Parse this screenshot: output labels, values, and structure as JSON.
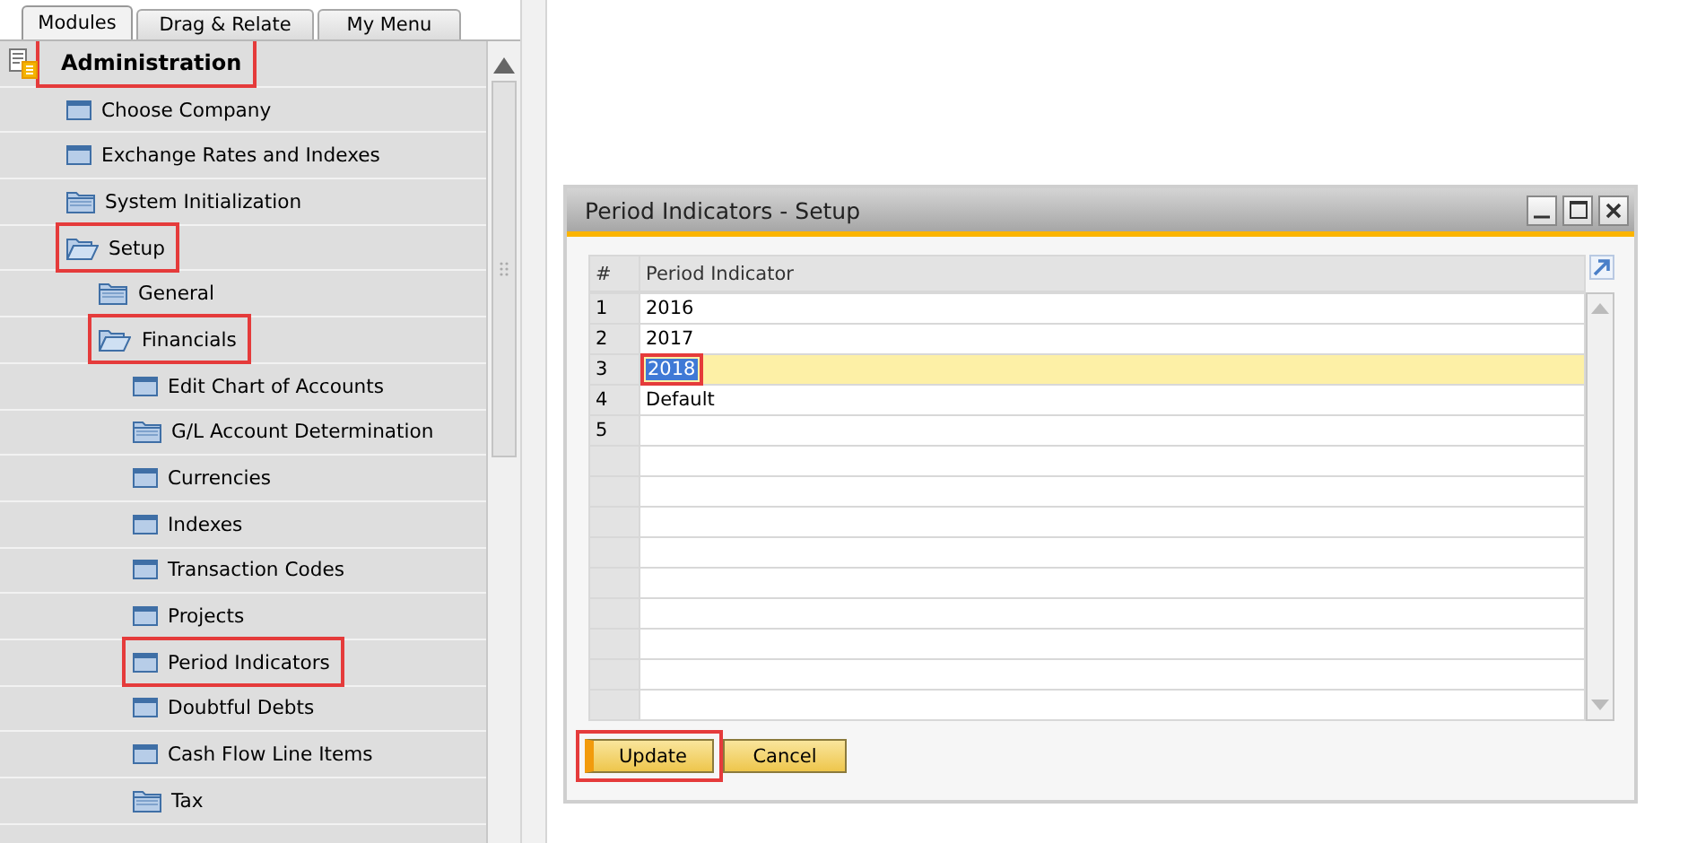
{
  "tabs": [
    {
      "label": "Modules",
      "selected": true
    },
    {
      "label": "Drag & Relate",
      "selected": false
    },
    {
      "label": "My Menu",
      "selected": false
    }
  ],
  "tree": [
    {
      "label": "Administration",
      "kind": "module",
      "highlighted": true,
      "children": [
        {
          "label": "Choose Company",
          "kind": "form",
          "highlighted": false
        },
        {
          "label": "Exchange Rates and Indexes",
          "kind": "form",
          "highlighted": false
        },
        {
          "label": "System Initialization",
          "kind": "folder",
          "expanded": false,
          "highlighted": false
        },
        {
          "label": "Setup",
          "kind": "folder",
          "expanded": true,
          "highlighted": true,
          "children": [
            {
              "label": "General",
              "kind": "folder",
              "expanded": false,
              "highlighted": false
            },
            {
              "label": "Financials",
              "kind": "folder",
              "expanded": true,
              "highlighted": true,
              "children": [
                {
                  "label": "Edit Chart of Accounts",
                  "kind": "form",
                  "highlighted": false
                },
                {
                  "label": "G/L Account Determination",
                  "kind": "folder",
                  "expanded": false,
                  "highlighted": false
                },
                {
                  "label": "Currencies",
                  "kind": "form",
                  "highlighted": false
                },
                {
                  "label": "Indexes",
                  "kind": "form",
                  "highlighted": false
                },
                {
                  "label": "Transaction Codes",
                  "kind": "form",
                  "highlighted": false
                },
                {
                  "label": "Projects",
                  "kind": "form",
                  "highlighted": false
                },
                {
                  "label": "Period Indicators",
                  "kind": "form",
                  "highlighted": true
                },
                {
                  "label": "Doubtful Debts",
                  "kind": "form",
                  "highlighted": false
                },
                {
                  "label": "Cash Flow Line Items",
                  "kind": "form",
                  "highlighted": false
                },
                {
                  "label": "Tax",
                  "kind": "folder",
                  "expanded": false,
                  "highlighted": false
                }
              ]
            }
          ]
        }
      ]
    }
  ],
  "dialog": {
    "title": "Period Indicators - Setup",
    "columns": [
      "#",
      "Period Indicator"
    ],
    "rows": [
      {
        "number": "1",
        "period_indicator": "2016",
        "selected": false
      },
      {
        "number": "2",
        "period_indicator": "2017",
        "selected": false
      },
      {
        "number": "3",
        "period_indicator": "2018",
        "selected": true,
        "highlighted": true
      },
      {
        "number": "4",
        "period_indicator": "Default",
        "selected": false
      },
      {
        "number": "5",
        "selected": false
      }
    ],
    "buttons": [
      {
        "label": "Update",
        "kind": "primary",
        "highlighted": true
      },
      {
        "label": "Cancel",
        "kind": "secondary",
        "highlighted": false
      }
    ]
  }
}
